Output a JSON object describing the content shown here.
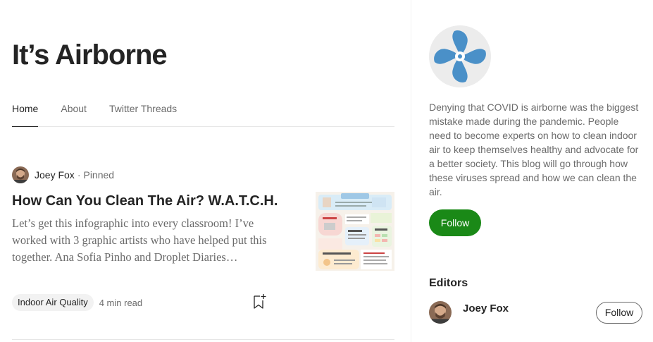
{
  "publication": {
    "title": "It’s Airborne"
  },
  "tabs": [
    {
      "label": "Home",
      "active": true
    },
    {
      "label": "About",
      "active": false
    },
    {
      "label": "Twitter Threads",
      "active": false
    }
  ],
  "post": {
    "author": "Joey Fox",
    "separator": "·",
    "pinned": "Pinned",
    "title": "How Can You Clean The Air? W.A.T.C.H.",
    "excerpt": "Let’s get this infographic into every classroom! I’ve worked with 3 graphic artists who have helped put this together. Ana Sofia Pinho and Droplet Diaries…",
    "tag": "Indoor Air Quality",
    "read_time": "4 min read",
    "thumbnail_icon": "infographic-thumbnail"
  },
  "sidebar": {
    "logo_icon": "fan-icon",
    "about": "Denying that COVID is airborne was the biggest mistake made during the pandemic. People need to become experts on how to clean indoor air to keep themselves healthy and advocate for a better society. This blog will go through how these viruses spread and how we can clean the air.",
    "follow_label": "Follow",
    "editors_heading": "Editors",
    "editors": [
      {
        "name": "Joey Fox",
        "follow_label": "Follow"
      }
    ]
  },
  "colors": {
    "follow_green": "#1a8917",
    "fan_blue": "#4a90c8",
    "text_primary": "#242424",
    "text_secondary": "#6b6b6b"
  }
}
